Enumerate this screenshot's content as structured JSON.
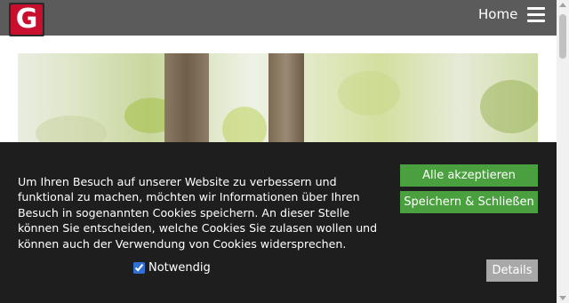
{
  "header": {
    "logo": {
      "letter": "G",
      "color": "#c8102e",
      "icon": "logo-g"
    },
    "nav": {
      "home_label": "Home"
    },
    "menu_icon": "hamburger-menu-icon"
  },
  "hero": {
    "description_icon": "forest-tree-photo"
  },
  "cookie_banner": {
    "text": "Um Ihren Besuch auf unserer Website zu verbessern und funktional zu machen, möchten wir Informationen über Ihren Besuch in sogenannten Cookies speichern. An dieser Stelle können Sie entscheiden, welche Cookies Sie zulasen wollen und können auch der Verwendung von Cookies widersprechen.",
    "accept_all_label": "Alle akzeptieren",
    "save_close_label": "Speichern & Schließen",
    "details_label": "Details",
    "necessary_label": "Notwendig",
    "necessary_checked": true,
    "accent_color": "#4a9f3e"
  }
}
